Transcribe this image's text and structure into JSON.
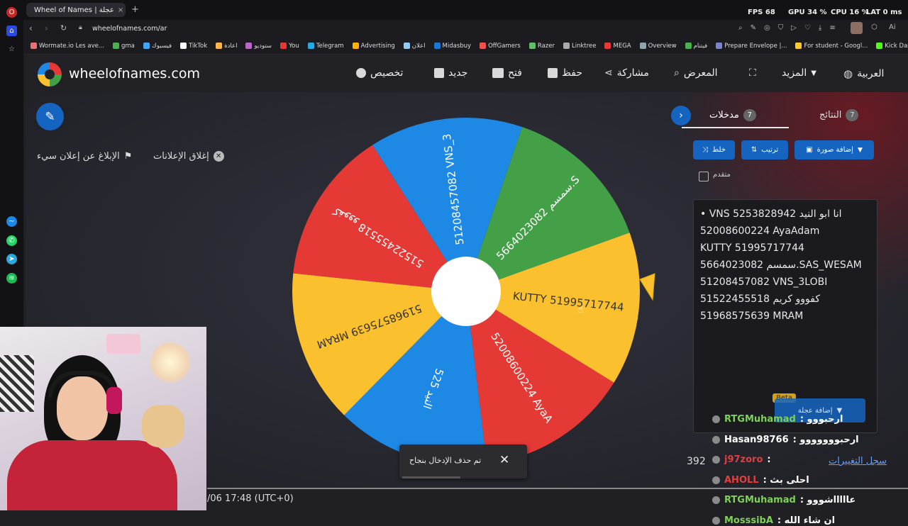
{
  "browser": {
    "tab_title": "Wheel of Names | عجلة",
    "url": "wheelofnames.com/ar",
    "stats": {
      "fps_label": "FPS",
      "fps": "68",
      "gpu_label": "GPU",
      "gpu": "34 %",
      "cpu_label": "CPU",
      "cpu": "16 %",
      "lat_label": "LAT",
      "lat": "0 ms"
    },
    "bookmarks": [
      "Wormate.io Les ave...",
      "gma",
      "فيسبوك",
      "TikTok",
      "اعادة",
      "ستوديو",
      "You",
      "Telegram",
      "Advertising",
      "اعلان",
      "Midasbuy",
      "OffGamers",
      "Razer",
      "Linktree",
      "MEGA",
      "Overview",
      "فيتنام",
      "Prepare Envelope |...",
      "For student - Googl...",
      "Kick Dashboard"
    ]
  },
  "site": {
    "logo_text": "wheelofnames.com",
    "nav": {
      "customize": "تخصيص",
      "new": "جديد",
      "open": "فتح",
      "save": "حفظ",
      "share": "مشاركة",
      "gallery": "المعرض",
      "more": "المزيد",
      "language": "العربية"
    }
  },
  "left": {
    "report_ad": "الإبلاغ عن إعلان سيء",
    "close_ads": "إغلاق الإعلانات"
  },
  "wheel": {
    "segments": [
      {
        "label": "51208457082 VNS_3",
        "color": "#1e88e5"
      },
      {
        "label": "5664023082 سمسم.S",
        "color": "#43a047"
      },
      {
        "label": "KUTTY 51995717744",
        "color": "#fbc02d"
      },
      {
        "label": "52008600224 AyaA",
        "color": "#e53935"
      },
      {
        "label": "525 النيد",
        "color": "#1e88e5"
      },
      {
        "label": "51968575639 MRAM",
        "color": "#fbc02d"
      },
      {
        "label": "51522455518 كفووو",
        "color": "#e53935"
      }
    ]
  },
  "panel": {
    "tab_entries": "مدخلات",
    "entries_count": "7",
    "tab_results": "النتائج",
    "results_count": "7",
    "shuffle": "خلط",
    "sort": "ترتيب",
    "add_image": "إضافة صورة",
    "advanced": "متقدم",
    "entries": [
      "• VNS انا ابو النيد 5253828942",
      "52008600224 AyaAdam",
      "KUTTY 51995717744",
      "5664023082 سمسم.SAS_WESAM",
      "51208457082 VNS_3LOBI",
      "51522455518 كفووو كريم",
      "51968575639 MRAM"
    ],
    "beta": "Beta",
    "add_wheel": "إضافة عجلة",
    "version": "392",
    "changelog": "سجل التغييرات"
  },
  "chat": [
    {
      "user": "RTGMuhamad",
      "msg": "ارحبووو",
      "color": "#7fd15a"
    },
    {
      "user": "Hasan98766",
      "msg": "ارحبووووووو",
      "color": "#ffffff"
    },
    {
      "user": "j97zoro",
      "msg": "",
      "color": "#e04040"
    },
    {
      "user": "AHOLL",
      "msg": "احلى بث",
      "color": "#e04040"
    },
    {
      "user": "RTGMuhamad",
      "msg": "عاااااشووو",
      "color": "#7fd15a"
    },
    {
      "user": "MosssibA",
      "msg": "ان شاء الله",
      "color": "#7fd15a"
    }
  ],
  "toast": {
    "message": "تم حذف الإدخال بنجاح"
  },
  "timestamp": "/06 17:48 (UTC+0)"
}
